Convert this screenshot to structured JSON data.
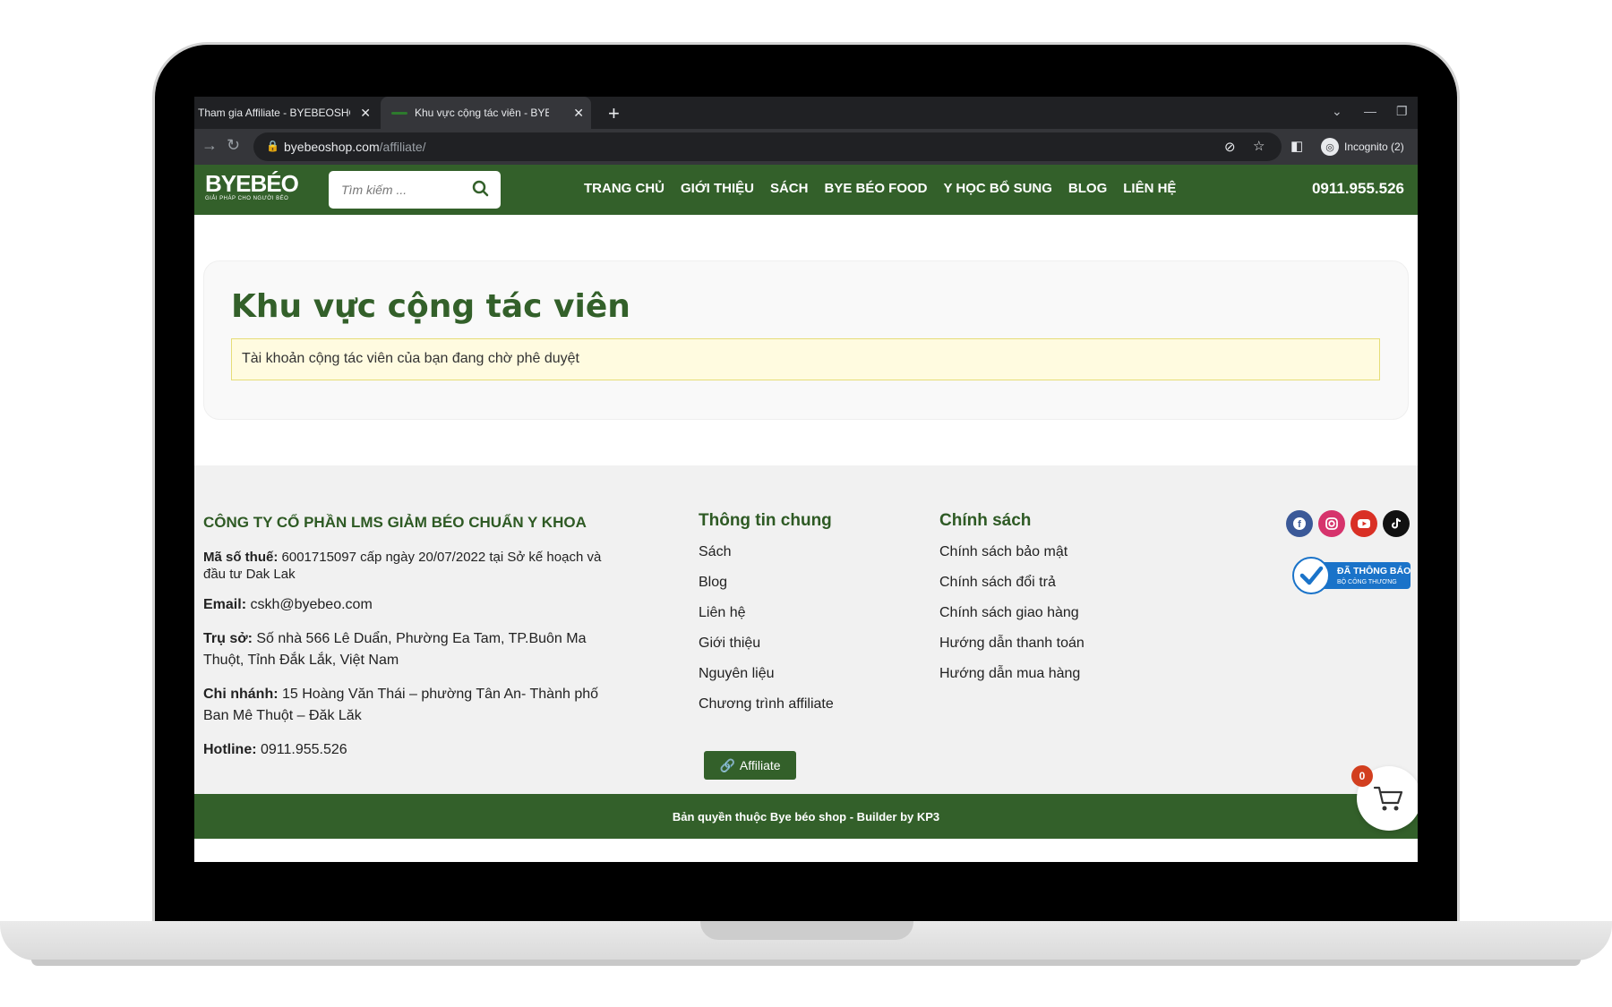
{
  "browser": {
    "tabs": [
      {
        "title": "Tham gia Affiliate - BYEBEOSHOP",
        "active": false
      },
      {
        "title": "Khu vực cộng tác viên - BYEBEOSHOP",
        "active": true
      }
    ],
    "url_domain": "byebeoshop.com",
    "url_path": "/affiliate/",
    "incognito_label": "Incognito (2)"
  },
  "header": {
    "logo_text": "BYEBÉO",
    "logo_tagline": "GIẢI PHÁP CHO NGƯỜI BÉO",
    "search_placeholder": "Tìm kiếm ...",
    "nav": [
      "TRANG CHỦ",
      "GIỚI THIỆU",
      "SÁCH",
      "BYE BÉO FOOD",
      "Y HỌC BỔ SUNG",
      "BLOG",
      "LIÊN HỆ"
    ],
    "phone": "0911.955.526",
    "brand_color": "#33602a"
  },
  "main": {
    "title": "Khu vực cộng tác viên",
    "notice": "Tài khoản cộng tác viên của bạn đang chờ phê duyệt"
  },
  "footer": {
    "company": "CÔNG TY CỔ PHẦN LMS GIẢM BÉO CHUẨN Y KHOA",
    "tax_label": "Mã số thuế:",
    "tax_value": " 6001715097 cấp ngày 20/07/2022 tại Sở kế hoạch và đầu tư Dak Lak",
    "email_label": "Email:",
    "email_value": " cskh@byebeo.com",
    "hq_label": "Trụ sở:",
    "hq_value": "  Số nhà 566 Lê Duẩn, Phường Ea Tam, TP.Buôn Ma Thuột, Tỉnh Đắk Lắk, Việt Nam",
    "branch_label": "Chi nhánh:",
    "branch_value": " 15 Hoàng Văn Thái – phường Tân An- Thành phố Ban Mê Thuột – Đăk Lăk",
    "hotline_label": "Hotline:",
    "hotline_value": " 0911.955.526",
    "general_title": "Thông tin chung",
    "general_links": [
      "Sách",
      "Blog",
      "Liên hệ",
      "Giới thiệu",
      "Nguyên liệu",
      "Chương trình affiliate"
    ],
    "affiliate_button": "Affiliate",
    "policy_title": "Chính sách",
    "policy_links": [
      "Chính sách bảo mật",
      "Chính sách đổi trả",
      "Chính sách giao hàng",
      "Hướng dẫn thanh toán",
      "Hướng dẫn mua hàng"
    ],
    "social_icons": [
      "facebook-icon",
      "instagram-icon",
      "youtube-icon",
      "tiktok-icon"
    ],
    "bct_badge_line1": "ĐÃ THÔNG BÁO",
    "bct_badge_line2": "BỘ CÔNG THƯƠNG",
    "copyright": "Bản quyền thuộc Bye béo shop - Builder by KP3"
  },
  "cart": {
    "count": "0"
  }
}
